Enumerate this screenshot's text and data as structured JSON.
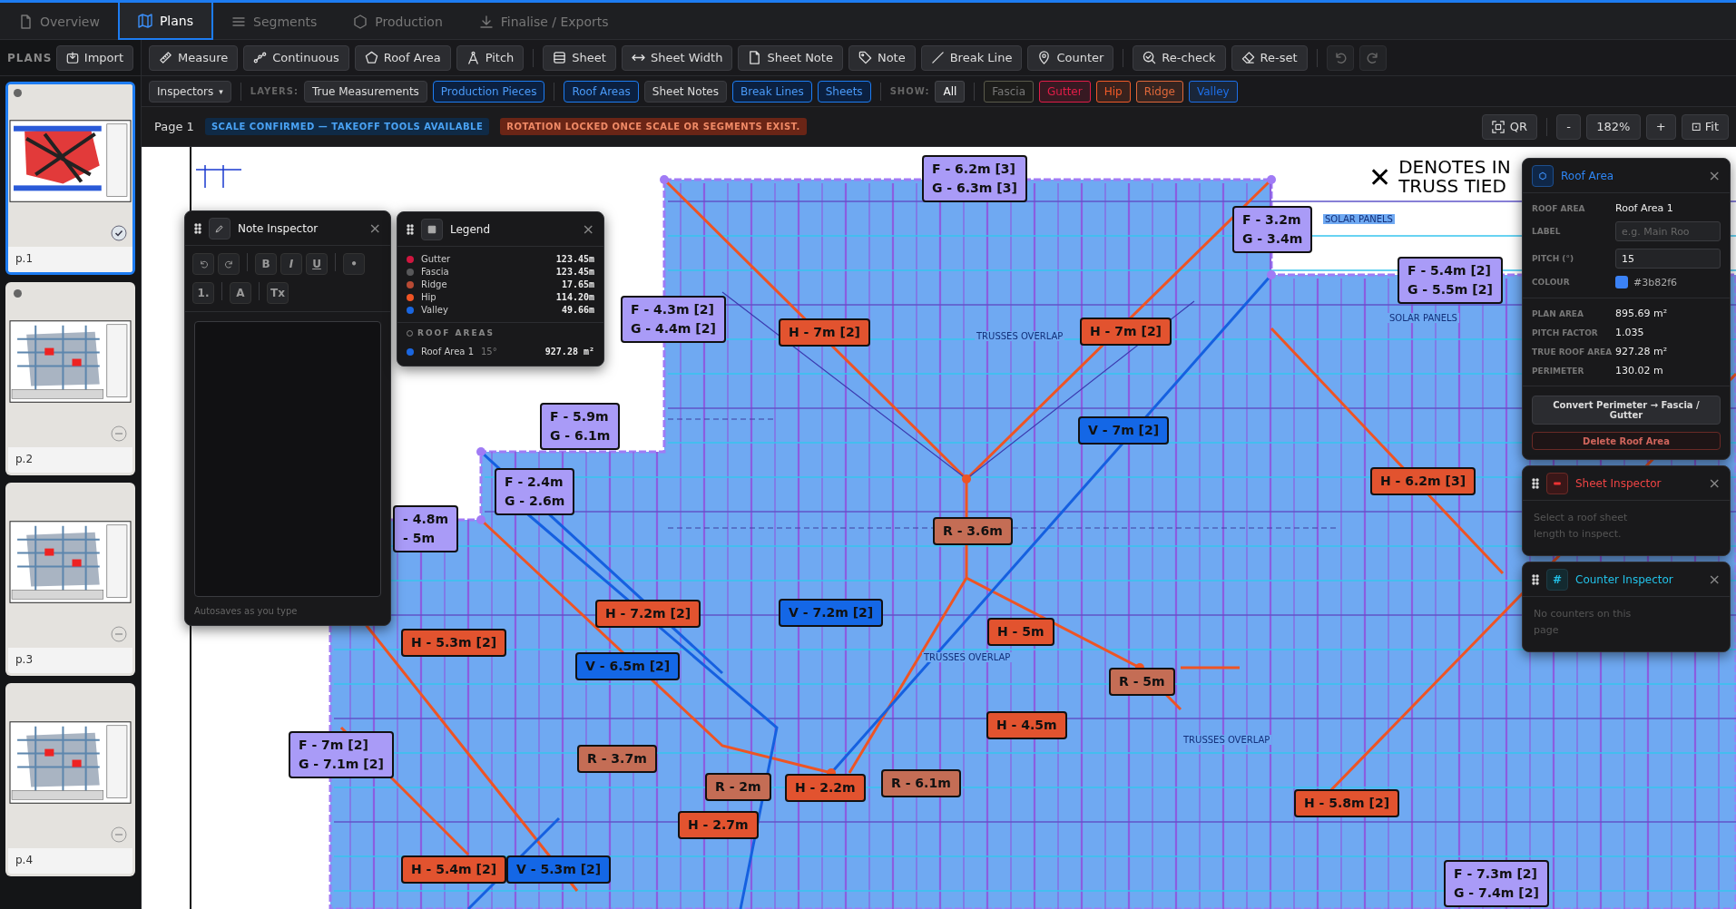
{
  "tabs": [
    {
      "label": "Overview",
      "selected": false
    },
    {
      "label": "Plans",
      "selected": true
    },
    {
      "label": "Segments",
      "selected": false
    },
    {
      "label": "Production",
      "selected": false
    },
    {
      "label": "Finalise / Exports",
      "selected": false
    }
  ],
  "sidebar": {
    "title": "PLANS",
    "import_button": "Import",
    "pages": [
      {
        "label": "p.1",
        "selected": true,
        "dot": true
      },
      {
        "label": "p.2",
        "selected": false,
        "dot": true
      },
      {
        "label": "p.3",
        "selected": false,
        "dot": false
      },
      {
        "label": "p.4",
        "selected": false,
        "dot": false
      }
    ]
  },
  "toolbar": {
    "groups": [
      [
        "Measure",
        "Continuous",
        "Roof Area",
        "Pitch"
      ],
      [
        "Sheet",
        "Sheet Width",
        "Sheet Note",
        "Note",
        "Break Line",
        "Counter"
      ],
      [
        "Re-check",
        "Re-set"
      ]
    ],
    "history": [
      {
        "disabled": true
      },
      {
        "disabled": true
      }
    ]
  },
  "layers_bar": {
    "inspectors": "Inspectors",
    "caret": "▾",
    "layers_label": "LAYERS:",
    "layers": [
      {
        "label": "True Measurements",
        "on": false
      },
      {
        "label": "Production Pieces",
        "on": true
      },
      {
        "label": "Roof Areas",
        "on": true
      },
      {
        "label": "Sheet Notes",
        "on": false
      },
      {
        "label": "Break Lines",
        "on": true
      },
      {
        "label": "Sheets",
        "on": true
      }
    ],
    "show_label": "SHOW:",
    "show": [
      {
        "label": "All",
        "kind": "all",
        "selected": true
      },
      {
        "label": "Fascia",
        "kind": "color",
        "color": "#5a5a4a",
        "selected": false
      },
      {
        "label": "Gutter",
        "kind": "color",
        "color": "#e11d48",
        "selected": true
      },
      {
        "label": "Hip",
        "kind": "color",
        "color": "#f05a28",
        "selected": true
      },
      {
        "label": "Ridge",
        "kind": "color",
        "color": "#e0683a",
        "selected": true
      },
      {
        "label": "Valley",
        "kind": "color",
        "color": "#1d6fe8",
        "selected": true
      }
    ]
  },
  "page_bar": {
    "page": "Page 1",
    "badges": [
      {
        "text": "SCALE CONFIRMED — TAKEOFF TOOLS AVAILABLE",
        "kind": "info"
      },
      {
        "text": "ROTATION LOCKED ONCE SCALE OR SEGMENTS EXIST.",
        "kind": "warning"
      }
    ],
    "qr": "QR",
    "zoom_out": "-",
    "zoom": "182%",
    "zoom_in": "+",
    "fit": "⊡ Fit"
  },
  "plan": {
    "notes": [
      {
        "text": "SOLAR PANELS"
      },
      {
        "text": "SOLAR PANELS"
      },
      {
        "text": "TRUSSES OVERLAP"
      },
      {
        "text": "TRUSSES OVERLAP"
      },
      {
        "text": "TRUSSES OVERLAP"
      }
    ],
    "legend_note": {
      "mark": "✕",
      "lines": [
        "DENOTES IN",
        "TRUSS TIED"
      ]
    },
    "labels": [
      {
        "kind": "fascia",
        "lines": [
          "F - 6.2m [3]",
          "G - 6.3m [3]"
        ]
      },
      {
        "kind": "fascia",
        "lines": [
          "F - 3.2m",
          "G - 3.4m"
        ]
      },
      {
        "kind": "fascia",
        "lines": [
          "F - 5.4m [2]",
          "G - 5.5m [2]"
        ]
      },
      {
        "kind": "fascia",
        "lines": [
          "F - 4.3m [2]",
          "G - 4.4m [2]"
        ]
      },
      {
        "kind": "hip",
        "lines": [
          "H - 7m [2]"
        ]
      },
      {
        "kind": "hip",
        "lines": [
          "H - 7m [2]"
        ]
      },
      {
        "kind": "fascia",
        "lines": [
          "F - 5.9m",
          "G - 6.1m"
        ]
      },
      {
        "kind": "valley",
        "lines": [
          "V - 7m [2]"
        ]
      },
      {
        "kind": "fascia",
        "lines": [
          "F - 2.4m",
          "G - 2.6m"
        ]
      },
      {
        "kind": "fascia",
        "lines": [
          "- 4.8m",
          "- 5m"
        ]
      },
      {
        "kind": "hip",
        "lines": [
          "H - 6.2m [3]"
        ]
      },
      {
        "kind": "ridge",
        "lines": [
          "R - 3.6m"
        ]
      },
      {
        "kind": "hip",
        "lines": [
          "H - 7.2m [2]"
        ]
      },
      {
        "kind": "valley",
        "lines": [
          "V - 7.2m [2]"
        ]
      },
      {
        "kind": "hip",
        "lines": [
          "H - 5m"
        ]
      },
      {
        "kind": "hip",
        "lines": [
          "H - 5.3m [2]"
        ]
      },
      {
        "kind": "valley",
        "lines": [
          "V - 6.5m [2]"
        ]
      },
      {
        "kind": "ridge",
        "lines": [
          "R - 5m"
        ]
      },
      {
        "kind": "hip",
        "lines": [
          "H - 4.5m"
        ]
      },
      {
        "kind": "fascia",
        "lines": [
          "F - 7m [2]",
          "G - 7.1m [2]"
        ]
      },
      {
        "kind": "ridge",
        "lines": [
          "R - 3.7m"
        ]
      },
      {
        "kind": "ridge",
        "lines": [
          "R - 2m"
        ]
      },
      {
        "kind": "hip",
        "lines": [
          "H - 2.2m"
        ]
      },
      {
        "kind": "ridge",
        "lines": [
          "R - 6.1m"
        ]
      },
      {
        "kind": "hip",
        "lines": [
          "H - 5.8m [2]"
        ]
      },
      {
        "kind": "hip",
        "lines": [
          "H - 2.7m"
        ]
      },
      {
        "kind": "hip",
        "lines": [
          "H - 5.4m [2]"
        ]
      },
      {
        "kind": "valley",
        "lines": [
          "V - 5.3m [2]"
        ]
      },
      {
        "kind": "fascia",
        "lines": [
          "F - 7.3m [2]",
          "G - 7.4m [2]"
        ]
      }
    ]
  },
  "note_inspector": {
    "title": "Note Inspector",
    "close": "×",
    "format_buttons": [
      "B",
      "I",
      "U",
      "•"
    ],
    "list_button": "1.",
    "color_button": "A",
    "clear_button": "Tx",
    "footer": "Autosaves as you type"
  },
  "legend": {
    "title": "Legend",
    "close": "×",
    "items": [
      {
        "name": "Gutter",
        "value": "123.45m",
        "color": "#d0163f"
      },
      {
        "name": "Fascia",
        "value": "123.45m",
        "color": "#58585a"
      },
      {
        "name": "Ridge",
        "value": "17.65m",
        "color": "#b84a34"
      },
      {
        "name": "Hip",
        "value": "114.20m",
        "color": "#ef5424"
      },
      {
        "name": "Valley",
        "value": "49.66m",
        "color": "#1a66e0"
      }
    ],
    "areas_heading": "ROOF AREAS",
    "areas": [
      {
        "name": "Roof Area 1",
        "pitch": "15°",
        "value": "927.28 m²",
        "color": "#1a66e0"
      }
    ]
  },
  "roof_area_panel": {
    "title": "Roof Area",
    "close": "×",
    "fields": [
      {
        "label": "ROOF AREA",
        "kind": "text",
        "value": "Roof Area 1"
      },
      {
        "label": "LABEL",
        "kind": "input",
        "placeholder": "e.g. Main Roo"
      },
      {
        "label": "PITCH (°)",
        "kind": "input",
        "value": "15"
      },
      {
        "label": "COLOUR",
        "kind": "color",
        "value": "#3b82f6",
        "color": "#3b82f6"
      }
    ],
    "stats": [
      {
        "label": "PLAN AREA",
        "value": "895.69 m²"
      },
      {
        "label": "PITCH FACTOR",
        "value": "1.035"
      },
      {
        "label": "TRUE ROOF AREA",
        "value": "927.28 m²"
      },
      {
        "label": "PERIMETER",
        "value": "130.02 m"
      }
    ],
    "convert_button": "Convert Perimeter → Fascia / Gutter",
    "delete_button": "Delete Roof Area"
  },
  "sheet_inspector": {
    "title": "Sheet Inspector",
    "close": "×",
    "message": "Select a roof sheet length to inspect."
  },
  "counter_inspector": {
    "title": "Counter Inspector",
    "icon_text": "#",
    "close": "×",
    "message": "No counters on this page"
  }
}
